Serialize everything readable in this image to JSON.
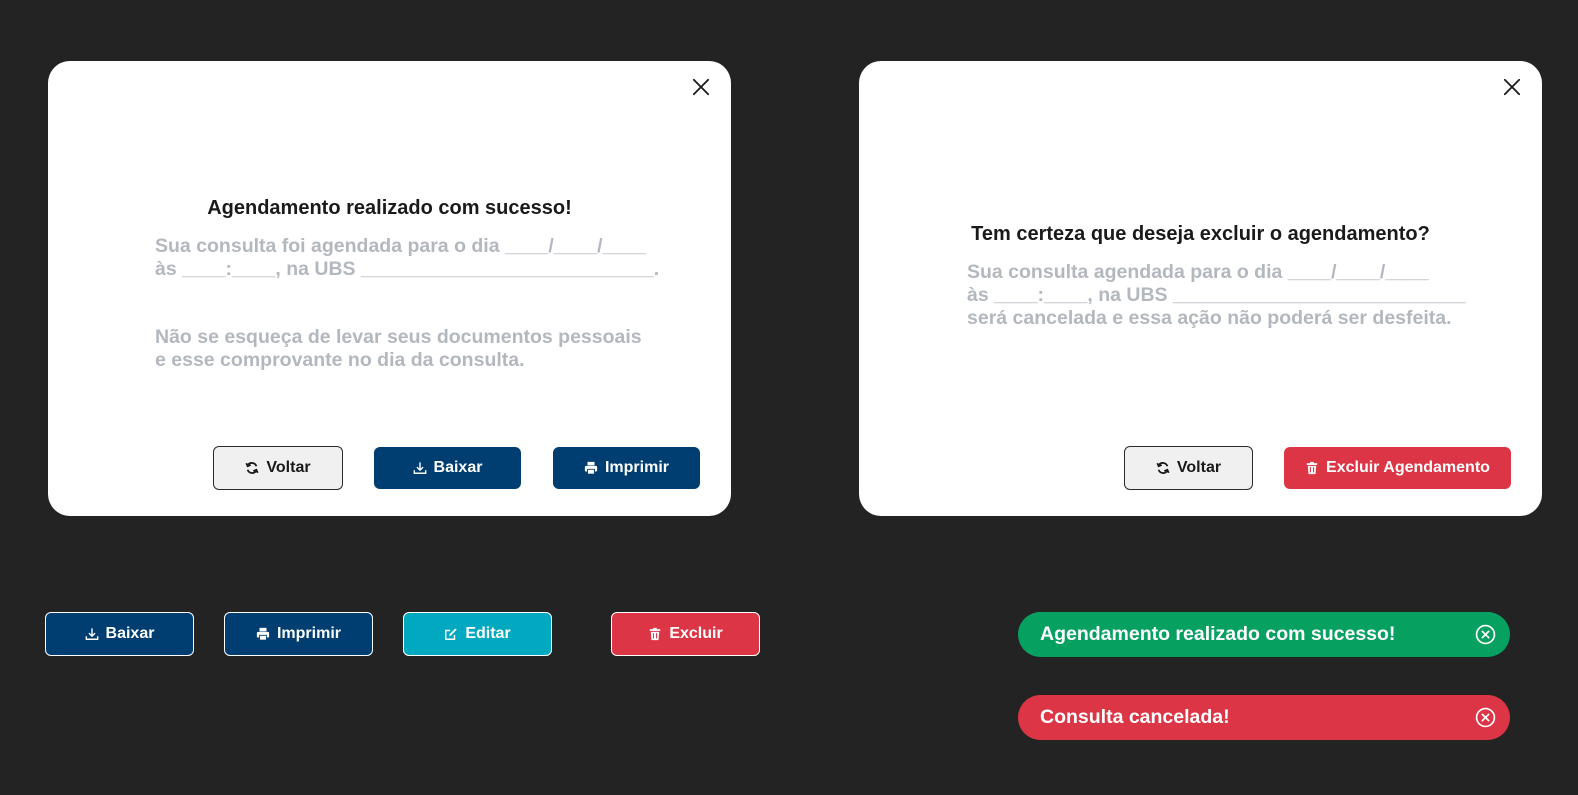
{
  "modal_success": {
    "title": "Agendamento realizado com sucesso!",
    "text_line1": "Sua consulta foi agendada para o dia ____/____/____",
    "text_line2": "às ____:____, na UBS ___________________________.",
    "note_line1": "Não se esqueça de levar seus documentos pessoais",
    "note_line2": "e esse comprovante no dia da consulta.",
    "buttons": {
      "back": "Voltar",
      "download": "Baixar",
      "print": "Imprimir"
    }
  },
  "modal_delete": {
    "title": "Tem certeza que deseja excluir o agendamento?",
    "text_line1": "Sua consulta agendada para o dia ____/____/____",
    "text_line2": "às ____:____, na UBS ___________________________",
    "text_line3": "será cancelada e essa ação não poderá ser desfeita.",
    "buttons": {
      "back": "Voltar",
      "delete": "Excluir Agendamento"
    }
  },
  "standalone_buttons": {
    "download": "Baixar",
    "print": "Imprimir",
    "edit": "Editar",
    "delete": "Excluir"
  },
  "toasts": {
    "success": "Agendamento realizado com sucesso!",
    "cancelled": "Consulta cancelada!"
  },
  "colors": {
    "navy": "#003e72",
    "red": "#dc3545",
    "teal": "#00a8c0",
    "green": "#06a160",
    "background": "#232323"
  },
  "icons": {
    "back": "refresh-icon",
    "download": "download-icon",
    "print": "printer-icon",
    "edit": "edit-icon",
    "delete": "trash-icon",
    "close": "close-icon",
    "toast_close": "circle-x-icon"
  }
}
